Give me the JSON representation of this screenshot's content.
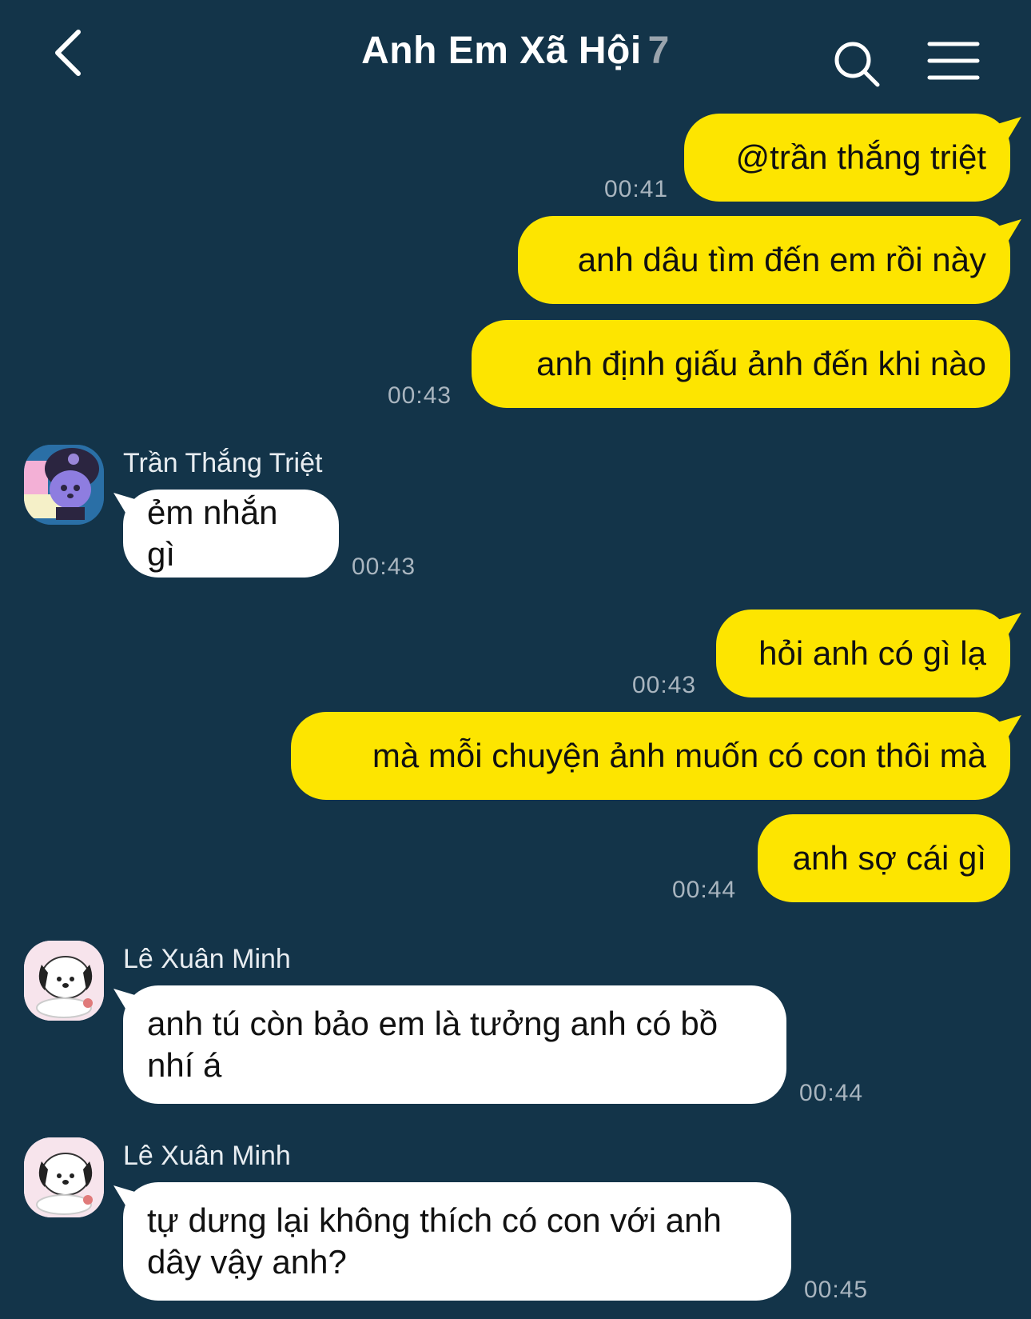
{
  "header": {
    "title": "Anh Em Xã Hội",
    "member_count": "7"
  },
  "messages": [
    {
      "dir": "out",
      "text": "@trần thắng triệt",
      "time": "00:41"
    },
    {
      "dir": "out",
      "text": "anh dâu tìm đến em rồi này",
      "time": ""
    },
    {
      "dir": "out",
      "text": "anh định giấu ảnh đến khi nào",
      "time": "00:43"
    },
    {
      "dir": "in",
      "sender": "Trần Thắng Triệt",
      "avatar": "kuromi-avatar",
      "text": "ẻm nhắn gì",
      "time": "00:43"
    },
    {
      "dir": "out",
      "text": "hỏi anh có gì lạ",
      "time": "00:43"
    },
    {
      "dir": "out",
      "text": "mà mỗi chuyện ảnh muốn có con thôi mà",
      "time": ""
    },
    {
      "dir": "out",
      "text": "anh sợ cái gì",
      "time": "00:44"
    },
    {
      "dir": "in",
      "sender": "Lê Xuân Minh",
      "avatar": "pochacco-avatar",
      "lines": [
        "anh tú còn bảo em là tưởng anh có bồ",
        "nhí á"
      ],
      "time": "00:44"
    },
    {
      "dir": "in",
      "sender": "Lê Xuân Minh",
      "avatar": "pochacco-avatar",
      "lines": [
        "tự dưng lại không thích có con với anh",
        "dây vậy anh?"
      ],
      "time": "00:45"
    }
  ],
  "colors": {
    "background": "#133449",
    "outgoing_bubble": "#fde500",
    "incoming_bubble": "#ffffff",
    "timestamp": "#a9b5bf"
  },
  "icons": [
    "back-chevron-icon",
    "search-icon",
    "menu-icon"
  ]
}
